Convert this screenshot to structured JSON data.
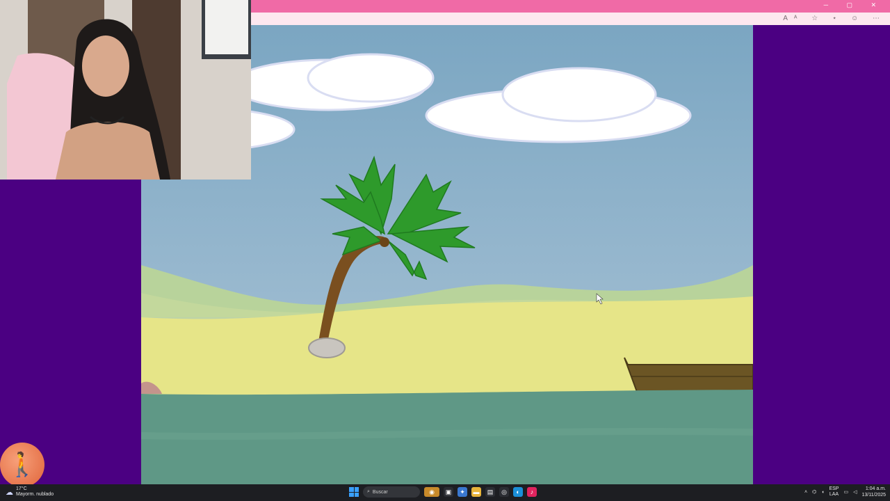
{
  "browser": {
    "window_controls": "─ ▢ ✕",
    "toolbar_icons": "Aᴬ ☆ ⋆ ☺ ⋯"
  },
  "game": {
    "scene": "island",
    "colors": {
      "sky_top": "#7ba6c2",
      "sky_bottom": "#a9c2d6",
      "hills": "#b4d198",
      "sand": "#e6e588",
      "sea": "#5f9886",
      "palm_leaves": "#2e9a2b",
      "trunk": "#7a4f1f",
      "rock": "#c9c5bf",
      "boat": "#6b5524"
    }
  },
  "taskbar": {
    "weather_temp": "17°C",
    "weather_desc": "Mayorm. nublado",
    "search_placeholder": "Buscar",
    "lang_top": "ESP",
    "lang_bottom": "LAA",
    "time": "1:04 a.m.",
    "date": "13/11/2025"
  }
}
